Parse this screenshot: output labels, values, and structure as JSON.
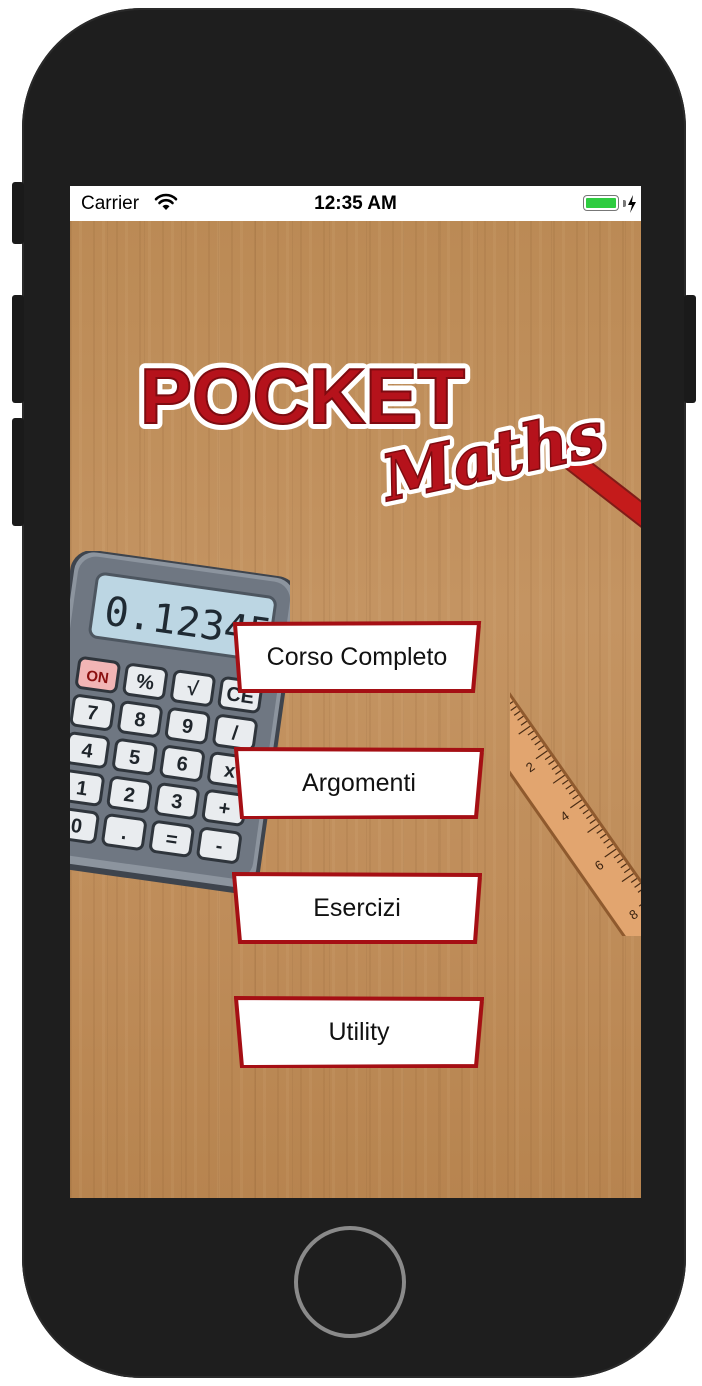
{
  "status_bar": {
    "carrier": "Carrier",
    "time": "12:35 AM",
    "battery_level": 1.0,
    "battery_color": "#2ecc40"
  },
  "logo": {
    "line1": "POCKET",
    "line2": "Maths",
    "brand_color": "#b5121b"
  },
  "calculator": {
    "display": "0.12345",
    "keys": [
      "ON",
      "%",
      "√",
      "CE",
      "7",
      "8",
      "9",
      "/",
      "4",
      "5",
      "6",
      "x",
      "1",
      "2",
      "3",
      "+",
      "0",
      ".",
      "=",
      "-"
    ]
  },
  "ruler": {
    "ticks": [
      "0",
      "2",
      "4",
      "6",
      "8"
    ]
  },
  "menu": {
    "items": [
      {
        "label": "Corso Completo"
      },
      {
        "label": "Argomenti"
      },
      {
        "label": "Esercizi"
      },
      {
        "label": "Utility"
      }
    ],
    "border_color": "#a50f14"
  }
}
